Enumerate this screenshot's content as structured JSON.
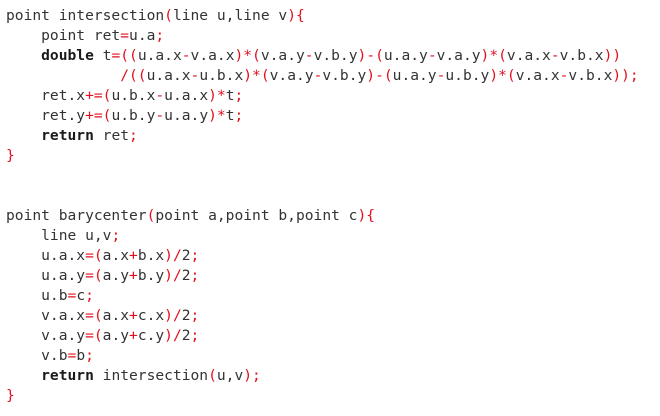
{
  "lines": [
    [
      [
        "p",
        "point intersection"
      ],
      [
        "o",
        "("
      ],
      [
        "p",
        "line u,line v"
      ],
      [
        "o",
        "){"
      ]
    ],
    [
      [
        "p",
        "    point ret"
      ],
      [
        "o",
        "="
      ],
      [
        "p",
        "u.a"
      ],
      [
        "o",
        ";"
      ]
    ],
    [
      [
        "k",
        "    double "
      ],
      [
        "p",
        "t"
      ],
      [
        "o",
        "=(("
      ],
      [
        "p",
        "u.a.x"
      ],
      [
        "o",
        "-"
      ],
      [
        "p",
        "v.a.x"
      ],
      [
        "o",
        ")*("
      ],
      [
        "p",
        "v.a.y"
      ],
      [
        "o",
        "-"
      ],
      [
        "p",
        "v.b.y"
      ],
      [
        "o",
        ")-("
      ],
      [
        "p",
        "u.a.y"
      ],
      [
        "o",
        "-"
      ],
      [
        "p",
        "v.a.y"
      ],
      [
        "o",
        ")*("
      ],
      [
        "p",
        "v.a.x"
      ],
      [
        "o",
        "-"
      ],
      [
        "p",
        "v.b.x"
      ],
      [
        "o",
        "))"
      ]
    ],
    [
      [
        "o",
        "             /(("
      ],
      [
        "p",
        "u.a.x"
      ],
      [
        "o",
        "-"
      ],
      [
        "p",
        "u.b.x"
      ],
      [
        "o",
        ")*("
      ],
      [
        "p",
        "v.a.y"
      ],
      [
        "o",
        "-"
      ],
      [
        "p",
        "v.b.y"
      ],
      [
        "o",
        ")-("
      ],
      [
        "p",
        "u.a.y"
      ],
      [
        "o",
        "-"
      ],
      [
        "p",
        "u.b.y"
      ],
      [
        "o",
        ")*("
      ],
      [
        "p",
        "v.a.x"
      ],
      [
        "o",
        "-"
      ],
      [
        "p",
        "v.b.x"
      ],
      [
        "o",
        "));"
      ]
    ],
    [
      [
        "p",
        "    ret.x"
      ],
      [
        "o",
        "+=("
      ],
      [
        "p",
        "u.b.x"
      ],
      [
        "o",
        "-"
      ],
      [
        "p",
        "u.a.x"
      ],
      [
        "o",
        ")*"
      ],
      [
        "p",
        "t"
      ],
      [
        "o",
        ";"
      ]
    ],
    [
      [
        "p",
        "    ret.y"
      ],
      [
        "o",
        "+=("
      ],
      [
        "p",
        "u.b.y"
      ],
      [
        "o",
        "-"
      ],
      [
        "p",
        "u.a.y"
      ],
      [
        "o",
        ")*"
      ],
      [
        "p",
        "t"
      ],
      [
        "o",
        ";"
      ]
    ],
    [
      [
        "k",
        "    return "
      ],
      [
        "p",
        "ret"
      ],
      [
        "o",
        ";"
      ]
    ],
    [
      [
        "o",
        "}"
      ]
    ],
    [],
    [],
    [
      [
        "p",
        "point barycenter"
      ],
      [
        "o",
        "("
      ],
      [
        "p",
        "point a,point b,point c"
      ],
      [
        "o",
        "){"
      ]
    ],
    [
      [
        "p",
        "    line u,v"
      ],
      [
        "o",
        ";"
      ]
    ],
    [
      [
        "p",
        "    u.a.x"
      ],
      [
        "o",
        "=("
      ],
      [
        "p",
        "a.x"
      ],
      [
        "o",
        "+"
      ],
      [
        "p",
        "b.x"
      ],
      [
        "o",
        ")/"
      ],
      [
        "p",
        "2"
      ],
      [
        "o",
        ";"
      ]
    ],
    [
      [
        "p",
        "    u.a.y"
      ],
      [
        "o",
        "=("
      ],
      [
        "p",
        "a.y"
      ],
      [
        "o",
        "+"
      ],
      [
        "p",
        "b.y"
      ],
      [
        "o",
        ")/"
      ],
      [
        "p",
        "2"
      ],
      [
        "o",
        ";"
      ]
    ],
    [
      [
        "p",
        "    u.b"
      ],
      [
        "o",
        "="
      ],
      [
        "p",
        "c"
      ],
      [
        "o",
        ";"
      ]
    ],
    [
      [
        "p",
        "    v.a.x"
      ],
      [
        "o",
        "=("
      ],
      [
        "p",
        "a.x"
      ],
      [
        "o",
        "+"
      ],
      [
        "p",
        "c.x"
      ],
      [
        "o",
        ")/"
      ],
      [
        "p",
        "2"
      ],
      [
        "o",
        ";"
      ]
    ],
    [
      [
        "p",
        "    v.a.y"
      ],
      [
        "o",
        "=("
      ],
      [
        "p",
        "a.y"
      ],
      [
        "o",
        "+"
      ],
      [
        "p",
        "c.y"
      ],
      [
        "o",
        ")/"
      ],
      [
        "p",
        "2"
      ],
      [
        "o",
        ";"
      ]
    ],
    [
      [
        "p",
        "    v.b"
      ],
      [
        "o",
        "="
      ],
      [
        "p",
        "b"
      ],
      [
        "o",
        ";"
      ]
    ],
    [
      [
        "k",
        "    return "
      ],
      [
        "p",
        "intersection"
      ],
      [
        "o",
        "("
      ],
      [
        "p",
        "u,v"
      ],
      [
        "o",
        ");"
      ]
    ],
    [
      [
        "o",
        "}"
      ]
    ]
  ]
}
